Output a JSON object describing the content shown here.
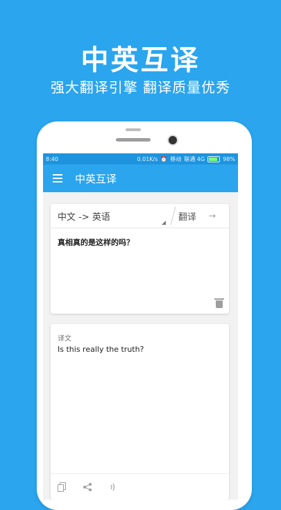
{
  "promo": {
    "title": "中英互译",
    "subtitle": "强大翻译引擎  翻译质量优秀"
  },
  "statusbar": {
    "time": "8:40",
    "speed": "0.01K/s",
    "carrier1": "移动",
    "carrier2": "联通 4G",
    "battery": "98%"
  },
  "appbar": {
    "title": "中英互译"
  },
  "input_card": {
    "language_pair": "中文 -> 英语",
    "translate_label": "翻译",
    "input_text": "真相真的是这样的吗？"
  },
  "output_card": {
    "label": "译文",
    "output_text": "Is this really the truth?"
  },
  "colors": {
    "background": "#2AA5EE",
    "statusbar": "#1E94DF",
    "appbar": "#2AA5EE"
  }
}
